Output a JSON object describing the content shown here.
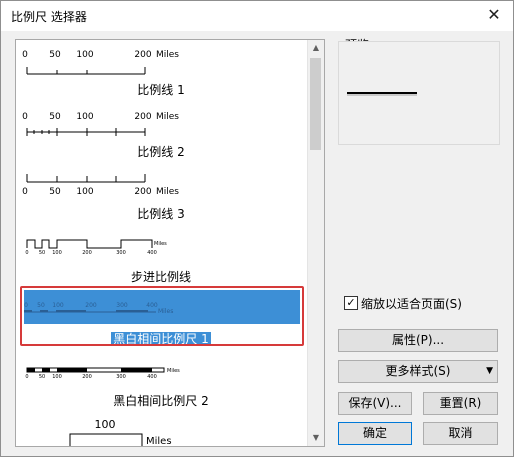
{
  "window": {
    "title": "比例尺 选择器",
    "close_icon": "close-icon"
  },
  "list": {
    "items": [
      {
        "label": "比例线 1",
        "ticks": [
          "0",
          "50",
          "100",
          "200"
        ],
        "unit": "Miles"
      },
      {
        "label": "比例线 2",
        "ticks": [
          "0",
          "50",
          "100",
          "200"
        ],
        "unit": "Miles"
      },
      {
        "label": "比例线 3",
        "ticks": [
          "0",
          "50",
          "100",
          "200"
        ],
        "unit": "Miles"
      },
      {
        "label": "步进比例线",
        "ticks": [
          "0",
          "50",
          "100",
          "200",
          "300",
          "400"
        ],
        "unit": "Miles"
      },
      {
        "label": "黑白相间比例尺 1",
        "ticks": [
          "0",
          "50",
          "100",
          "200",
          "300",
          "400"
        ],
        "unit": "Miles",
        "selected": true
      },
      {
        "label": "黑白相间比例尺 2",
        "ticks": [
          "0",
          "50",
          "100",
          "200",
          "300",
          "400"
        ],
        "unit": "Miles"
      },
      {
        "label": "",
        "ticks": [
          "100"
        ],
        "unit": "Miles"
      }
    ]
  },
  "preview": {
    "label": "预览"
  },
  "options": {
    "fit_to_page_label": "缩放以适合页面(S)",
    "fit_to_page_checked": true
  },
  "buttons": {
    "properties": "属性(P)...",
    "more_styles": "更多样式(S)",
    "save": "保存(V)...",
    "reset": "重置(R)",
    "ok": "确定",
    "cancel": "取消"
  },
  "colors": {
    "selection": "#3d8fd6",
    "highlight_frame": "#d63a3a"
  }
}
